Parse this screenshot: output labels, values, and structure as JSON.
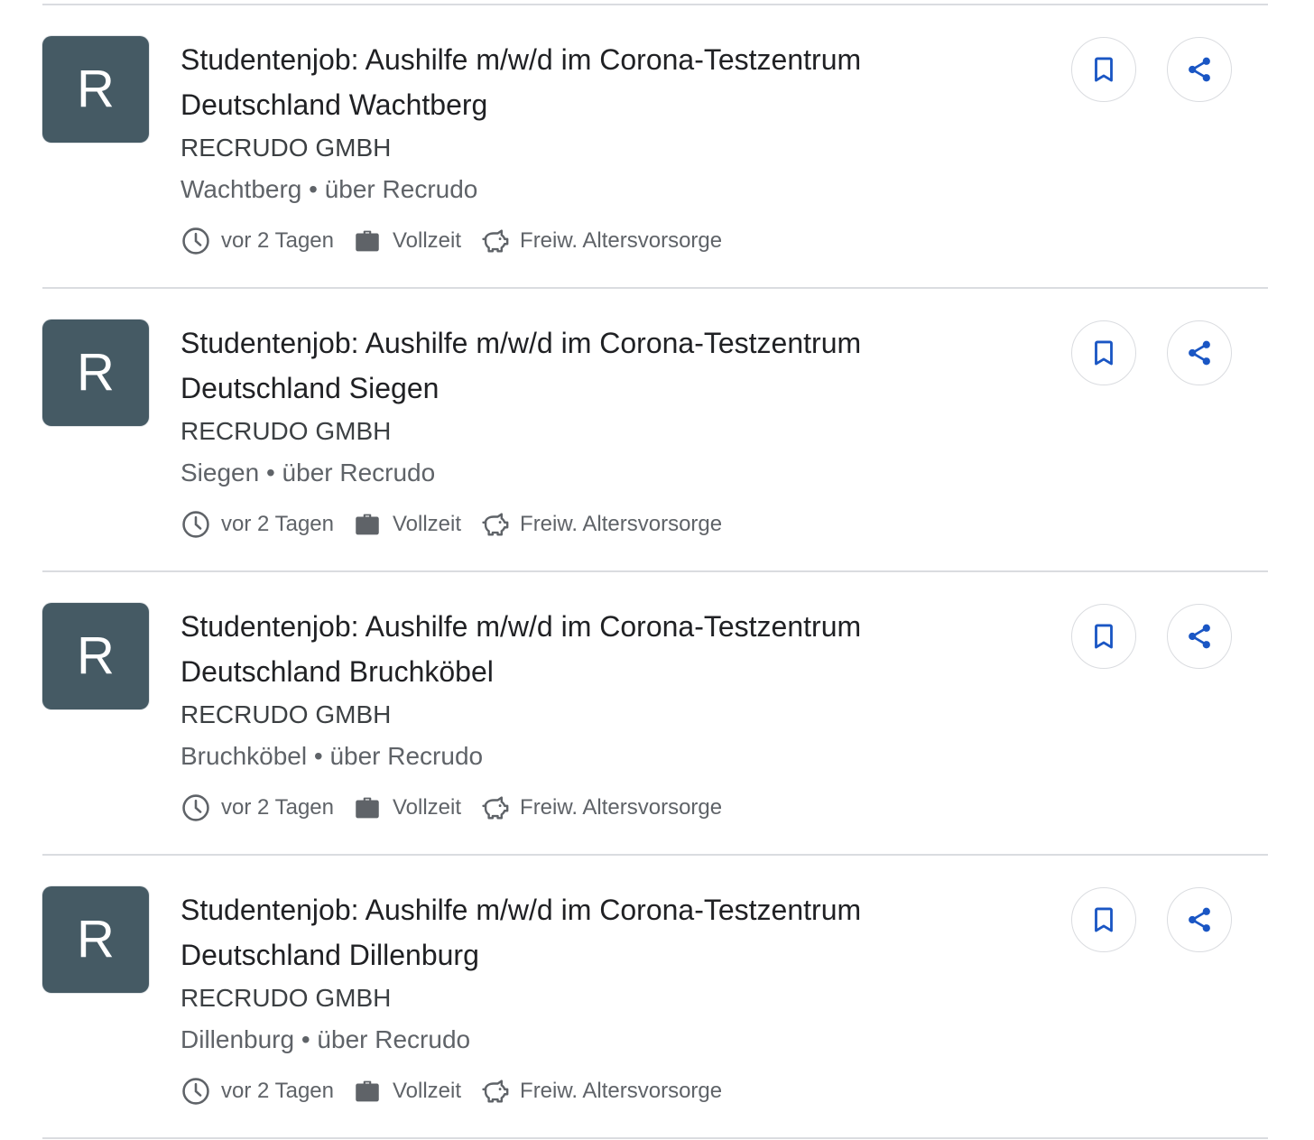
{
  "colors": {
    "logo_bg": "#455a64",
    "action_icon": "#1a56c4",
    "divider": "#dadce0",
    "meta_text": "#5f6368"
  },
  "jobs": [
    {
      "logo_letter": "R",
      "title_line1": "Studentenjob: Aushilfe m/w/d im Corona-Testzentrum",
      "title_line2": "Deutschland Wachtberg",
      "company": "RECRUDO GMBH",
      "location": "Wachtberg • über Recrudo",
      "posted": "vor 2 Tagen",
      "employment_type": "Vollzeit",
      "benefit": "Freiw. Altersvorsorge"
    },
    {
      "logo_letter": "R",
      "title_line1": "Studentenjob: Aushilfe m/w/d im Corona-Testzentrum",
      "title_line2": "Deutschland Siegen",
      "company": "RECRUDO GMBH",
      "location": "Siegen • über Recrudo",
      "posted": "vor 2 Tagen",
      "employment_type": "Vollzeit",
      "benefit": "Freiw. Altersvorsorge"
    },
    {
      "logo_letter": "R",
      "title_line1": "Studentenjob: Aushilfe m/w/d im Corona-Testzentrum",
      "title_line2": "Deutschland Bruchköbel",
      "company": "RECRUDO GMBH",
      "location": "Bruchköbel • über Recrudo",
      "posted": "vor 2 Tagen",
      "employment_type": "Vollzeit",
      "benefit": "Freiw. Altersvorsorge"
    },
    {
      "logo_letter": "R",
      "title_line1": "Studentenjob: Aushilfe m/w/d im Corona-Testzentrum",
      "title_line2": "Deutschland Dillenburg",
      "company": "RECRUDO GMBH",
      "location": "Dillenburg • über Recrudo",
      "posted": "vor 2 Tagen",
      "employment_type": "Vollzeit",
      "benefit": "Freiw. Altersvorsorge"
    }
  ]
}
